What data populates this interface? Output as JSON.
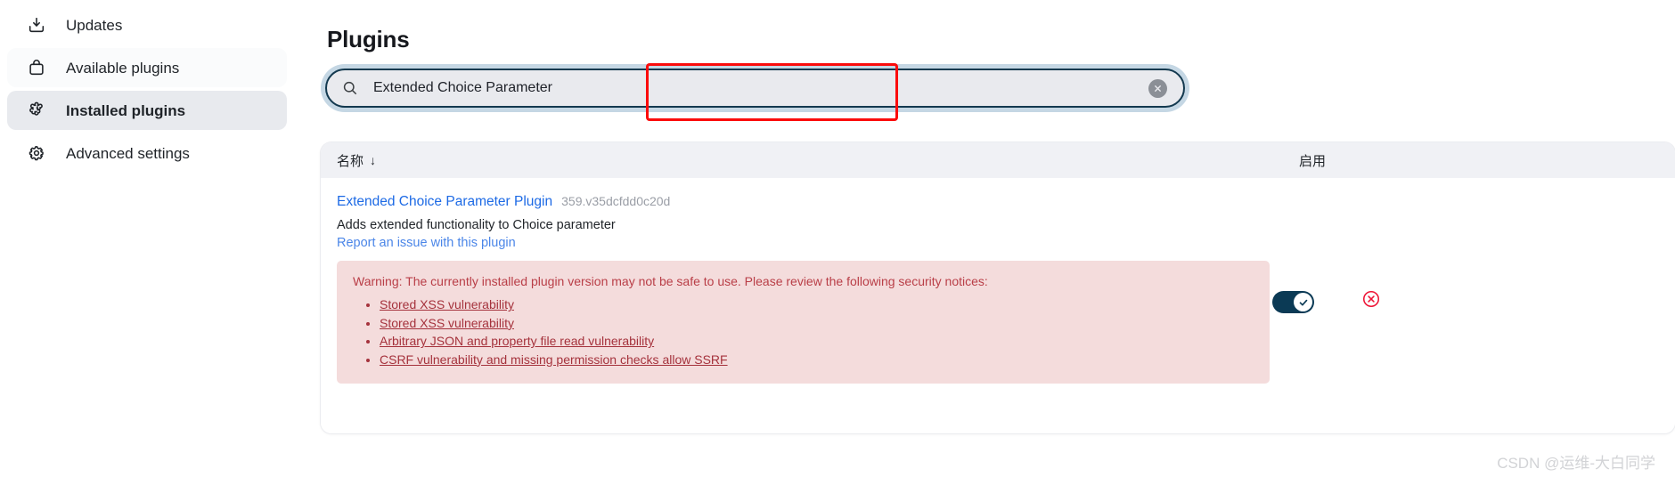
{
  "sidebar": {
    "items": [
      {
        "label": "Updates",
        "icon": "download-icon",
        "state": "default"
      },
      {
        "label": "Available plugins",
        "icon": "shopping-bag-icon",
        "state": "hover"
      },
      {
        "label": "Installed plugins",
        "icon": "puzzle-piece-icon",
        "state": "active"
      },
      {
        "label": "Advanced settings",
        "icon": "gear-icon",
        "state": "default"
      }
    ]
  },
  "header": {
    "title": "Plugins"
  },
  "search": {
    "value": "Extended Choice Parameter",
    "placeholder": "",
    "icon": "search-icon",
    "clear_icon": "close-circle-icon",
    "focused": true,
    "annotation_color": "#fb0c0c"
  },
  "table": {
    "columns": [
      {
        "key": "name",
        "label": "名称",
        "sort": "↓",
        "sorted": true
      },
      {
        "key": "enabled",
        "label": "启用"
      }
    ],
    "rows": [
      {
        "name": "Extended Choice Parameter Plugin",
        "version": "359.v35dcfdd0c20d",
        "description": "Adds extended functionality to Choice parameter",
        "report_link": "Report an issue with this plugin",
        "warning": {
          "text": "Warning: The currently installed plugin version may not be safe to use. Please review the following security notices:",
          "notices": [
            "Stored XSS vulnerability",
            "Stored XSS vulnerability",
            "Arbitrary JSON and property file read vulnerability",
            "CSRF vulnerability and missing permission checks allow SSRF"
          ]
        },
        "enabled": true,
        "uninstall_icon": "close-circle-icon"
      }
    ]
  },
  "colors": {
    "link": "#1d6ae5",
    "warning_bg": "#f4dcdc",
    "warning_text": "#b93e47",
    "toggle_on": "#0b3a55",
    "danger": "#ee1436",
    "search_border": "#13394f"
  },
  "watermark": {
    "text": "CSDN @运维-大白同学"
  }
}
